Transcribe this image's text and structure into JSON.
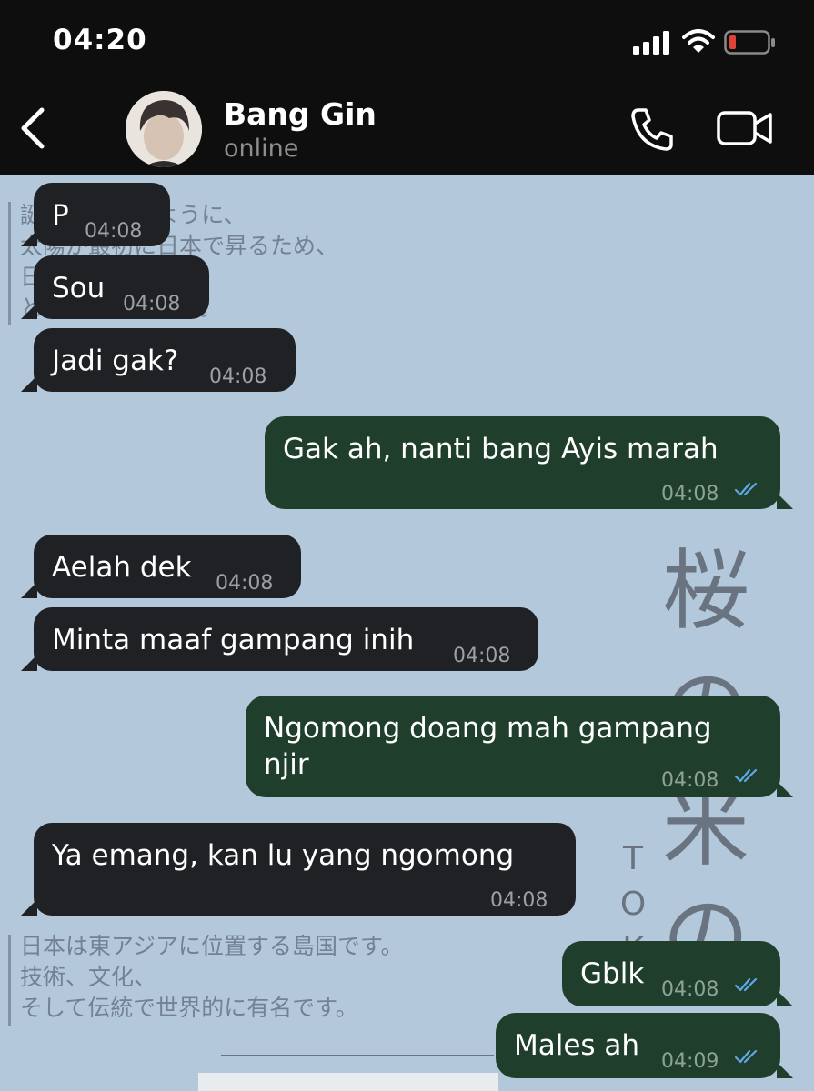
{
  "status_bar": {
    "time": "04:20"
  },
  "header": {
    "contact_name": "Bang Gin",
    "contact_status": "online",
    "icons": [
      "back-icon",
      "phone-icon",
      "video-icon"
    ]
  },
  "wallpaper": {
    "block1": "誕生しているように、\n太陽が最初に日本で昇るため、\n日出ずる国\nと呼ばれています。",
    "block2": "日本は東アジアに位置する島国です。\n技術、文化、\nそして伝統で世界的に有名です。",
    "big_chars": [
      "桜",
      "の",
      "米",
      "の"
    ],
    "tok_chars": [
      "T",
      "O",
      "K"
    ]
  },
  "messages": [
    {
      "direction": "in",
      "text": "P",
      "time": "04:08"
    },
    {
      "direction": "in",
      "text": "Sou",
      "time": "04:08"
    },
    {
      "direction": "in",
      "text": "Jadi gak?",
      "time": "04:08"
    },
    {
      "direction": "out",
      "text": "Gak ah, nanti bang Ayis marah",
      "time": "04:08",
      "read": true
    },
    {
      "direction": "in",
      "text": "Aelah dek",
      "time": "04:08"
    },
    {
      "direction": "in",
      "text": "Minta maaf gampang inih",
      "time": "04:08"
    },
    {
      "direction": "out",
      "text_line1": "Ngomong doang mah gampang",
      "text_line2": "njir",
      "time": "04:08",
      "read": true
    },
    {
      "direction": "in",
      "text": "Ya emang, kan lu yang ngomong",
      "time": "04:08"
    },
    {
      "direction": "out",
      "text": "Gblk",
      "time": "04:08",
      "read": true
    },
    {
      "direction": "out",
      "text": "Males ah",
      "time": "04:09",
      "read": true
    }
  ],
  "colors": {
    "incoming_bubble": "#1f2124",
    "outgoing_bubble": "#1f3f2c",
    "read_ticks": "#5ea8e8",
    "wallpaper": "#b4c8dc",
    "header": "#0e0e0e"
  }
}
